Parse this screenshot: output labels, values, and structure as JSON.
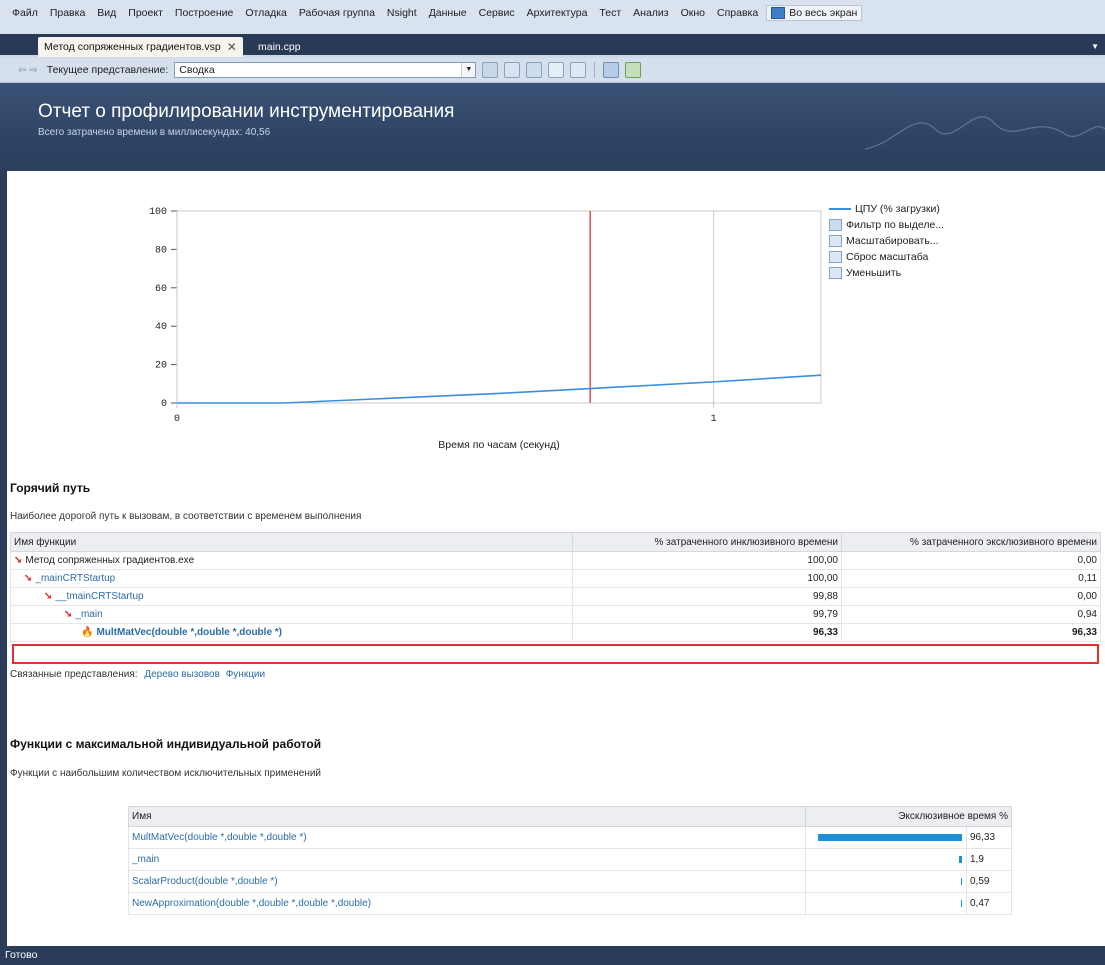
{
  "menu": {
    "items": [
      "Файл",
      "Правка",
      "Вид",
      "Проект",
      "Построение",
      "Отладка",
      "Рабочая группа",
      "Nsight",
      "Данные",
      "Сервис",
      "Архитектура",
      "Тест",
      "Анализ",
      "Окно",
      "Справка"
    ],
    "fullscreen_label": "Во весь экран"
  },
  "tabs": {
    "active": "Метод сопряженных градиентов.vsp",
    "inactive": "main.cpp"
  },
  "toolbar": {
    "current_view_label": "Текущее представление:",
    "current_view_value": "Сводка"
  },
  "banner": {
    "title": "Отчет о профилировании инструментирования",
    "subtitle": "Всего затрачено времени в миллисекундах: 40,56"
  },
  "chart_data": {
    "type": "line",
    "x": [
      0,
      0.2,
      0.4,
      0.6,
      0.77,
      1.0,
      1.2
    ],
    "series": [
      {
        "name": "ЦПУ (% загрузки)",
        "values": [
          0,
          0,
          2.5,
          5,
          7.5,
          11,
          14.5
        ]
      }
    ],
    "xlabel": "Время по часам (секунд)",
    "ylabel": "",
    "xlim": [
      0,
      1.2
    ],
    "ylim": [
      0,
      100
    ],
    "xticks": [
      "0",
      "1"
    ],
    "yticks": [
      "0",
      "20",
      "40",
      "60",
      "80",
      "100"
    ],
    "marker_x": 0.77,
    "series_color": "#3a8fde",
    "marker_color": "#e05050"
  },
  "chart_legend": {
    "series_label": "ЦПУ (% загрузки)",
    "actions": [
      "Фильтр по выделе...",
      "Масштабировать...",
      "Сброс масштаба",
      "Уменьшить"
    ]
  },
  "hot_path": {
    "title": "Горячий путь",
    "description": "Наиболее дорогой путь к вызовам, в соответствии с временем выполнения",
    "columns": [
      "Имя функции",
      "% затраченного инклюзивного времени",
      "% затраченного эксклюзивного времени"
    ],
    "rows": [
      {
        "name": "Метод сопряженных градиентов.exe",
        "inclusive": "100,00",
        "exclusive": "0,00"
      },
      {
        "name": "_mainCRTStartup",
        "inclusive": "100,00",
        "exclusive": "0,11"
      },
      {
        "name": "__tmainCRTStartup",
        "inclusive": "99,88",
        "exclusive": "0,00"
      },
      {
        "name": "_main",
        "inclusive": "99,79",
        "exclusive": "0,94"
      },
      {
        "name": "MultMatVec(double *,double *,double *)",
        "inclusive": "96,33",
        "exclusive": "96,33"
      }
    ],
    "related_label": "Связанные представления:",
    "related_links": [
      "Дерево вызовов",
      "Функции"
    ]
  },
  "top_functions": {
    "title": "Функции с максимальной индивидуальной работой",
    "description": "Функции с наибольшим количеством исключительных применений",
    "columns": [
      "Имя",
      "Эксклюзивное время %"
    ],
    "rows": [
      {
        "name": "MultMatVec(double *,double *,double *)",
        "value": "96,33",
        "percent": 96.33
      },
      {
        "name": "_main",
        "value": "1,9",
        "percent": 1.9
      },
      {
        "name": "ScalarProduct(double *,double *)",
        "value": "0,59",
        "percent": 0.59
      },
      {
        "name": "NewApproximation(double *,double *,double *,double)",
        "value": "0,47",
        "percent": 0.47
      }
    ]
  },
  "status": {
    "text": "Готово"
  }
}
